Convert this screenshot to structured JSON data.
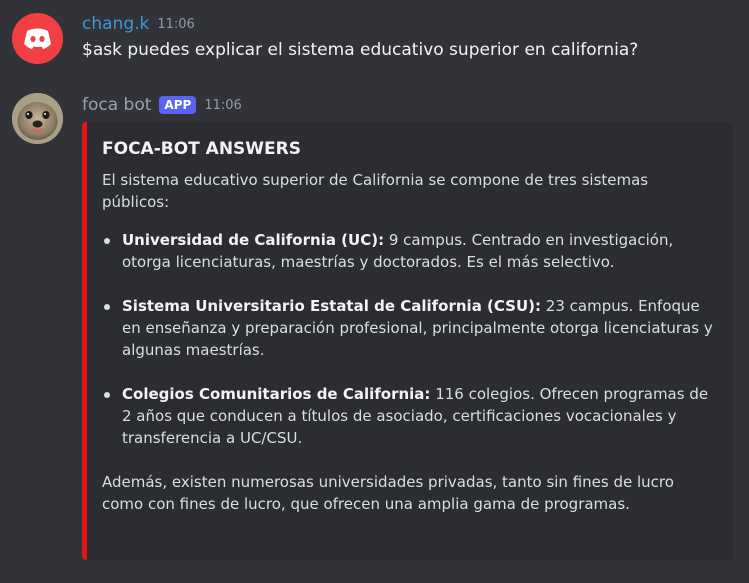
{
  "messages": [
    {
      "username": "chang.k",
      "timestamp": "11:06",
      "avatar_icon": "discord-logo-icon",
      "text": "$ask puedes explicar el sistema educativo superior en california?"
    },
    {
      "username": "foca bot",
      "badge": "APP",
      "timestamp": "11:06",
      "avatar_icon": "seal-avatar-icon",
      "embed": {
        "accent_color": "#e3151a",
        "title": "FOCA-BOT ANSWERS",
        "intro": "El sistema educativo superior de California se compone de tres sistemas públicos:",
        "points": [
          {
            "bold": "Universidad de California (UC):",
            "text": " 9 campus. Centrado en investigación, otorga licenciaturas, maestrías y doctorados. Es el más selectivo."
          },
          {
            "bold": "Sistema Universitario Estatal de California (CSU):",
            "text": " 23 campus. Enfoque en enseñanza y preparación profesional, principalmente otorga licenciaturas y algunas maestrías."
          },
          {
            "bold": "Colegios Comunitarios de California:",
            "text": " 116 colegios. Ofrecen programas de 2 años que conducen a títulos de asociado, certificaciones vocacionales y transferencia a UC/CSU."
          }
        ],
        "outro": "Además, existen numerosas universidades privadas, tanto sin fines de lucro como con fines de lucro, que ofrecen una amplia gama de programas."
      }
    }
  ],
  "colors": {
    "background": "#313338",
    "embed_background": "#2b2d31",
    "badge": "#5865f2",
    "username_1": "#3f97d8",
    "username_2": "#99a3ad"
  }
}
